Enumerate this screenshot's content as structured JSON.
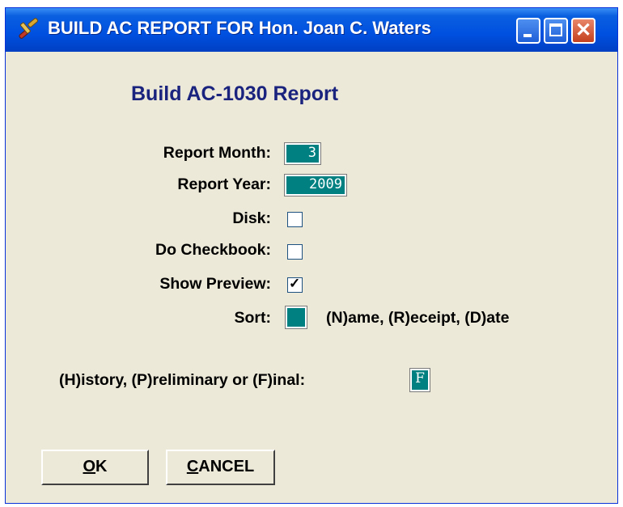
{
  "window": {
    "title": "BUILD AC REPORT FOR Hon. Joan C. Waters",
    "heading": "Build AC-1030 Report"
  },
  "form": {
    "report_month_label": "Report Month:",
    "report_month_value": "3",
    "report_year_label": "Report Year:",
    "report_year_value": "2009",
    "disk_label": "Disk:",
    "disk_checked": false,
    "checkbook_label": "Do Checkbook:",
    "checkbook_checked": false,
    "preview_label": "Show Preview:",
    "preview_checked": true,
    "sort_label": "Sort:",
    "sort_value": "",
    "sort_hint": "(N)ame, (R)eceipt, (D)ate",
    "mode_label": "(H)istory, (P)reliminary or (F)inal:",
    "mode_value": "F"
  },
  "buttons": {
    "ok_mnemonic": "O",
    "ok_rest": "K",
    "cancel_mnemonic": "C",
    "cancel_rest": "ANCEL"
  },
  "colors": {
    "field_bg": "#008080",
    "heading": "#1a237e",
    "titlebar": "#0050e0",
    "window_bg": "#ece9d8"
  },
  "icons": [
    "gavel-icon",
    "minimize-icon",
    "maximize-icon",
    "close-icon"
  ]
}
